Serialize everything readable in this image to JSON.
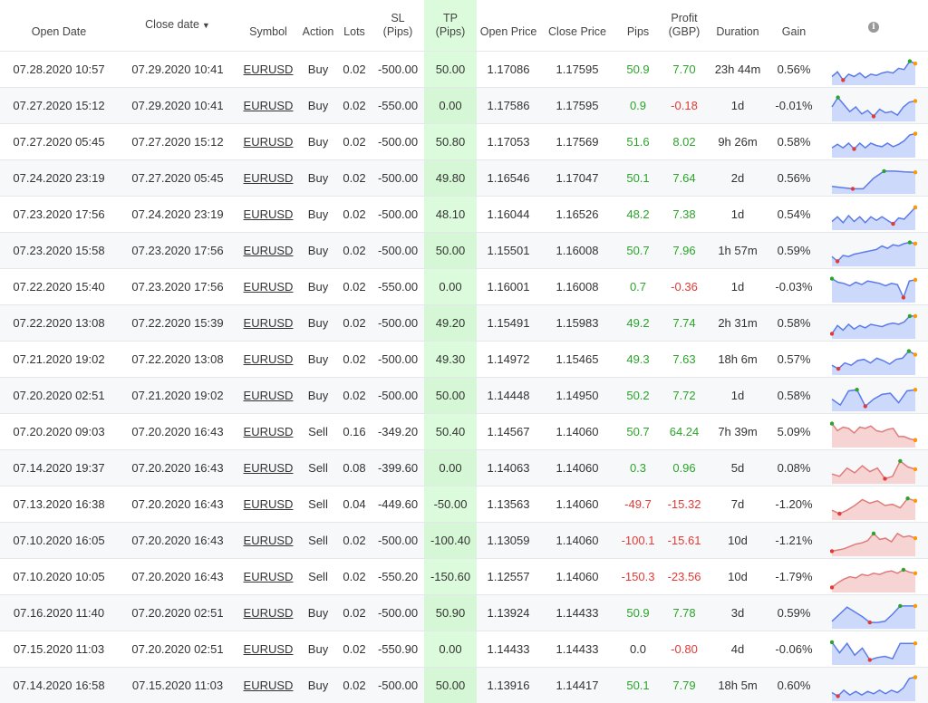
{
  "headers": {
    "open_date": "Open Date",
    "close_date": "Close date",
    "close_date_sort": "▼",
    "symbol": "Symbol",
    "action": "Action",
    "lots": "Lots",
    "sl_line1": "SL",
    "sl_line2": "(Pips)",
    "tp_line1": "TP",
    "tp_line2": "(Pips)",
    "open_price": "Open Price",
    "close_price": "Close Price",
    "pips": "Pips",
    "profit_line1": "Profit",
    "profit_line2": "(GBP)",
    "duration": "Duration",
    "gain": "Gain",
    "info": "i"
  },
  "colors": {
    "positive": "#2aa52a",
    "negative": "#e53935",
    "buy_line": "#5b7bea",
    "buy_fill": "#cdd9fb",
    "sell_line": "#e07b7b",
    "sell_fill": "#f6d4d4",
    "tp_bg": "#dcfbdc"
  },
  "rows": [
    {
      "open": "07.28.2020 10:57",
      "close": "07.29.2020 10:41",
      "symbol": "EURUSD",
      "action": "Buy",
      "lots": "0.02",
      "sl": "-500.00",
      "tp": "50.00",
      "open_price": "1.17086",
      "close_price": "1.17595",
      "pips": "50.9",
      "profit": "7.70",
      "duration": "23h 44m",
      "gain": "0.56%",
      "spark": [
        0.25,
        0.45,
        0.1,
        0.35,
        0.25,
        0.4,
        0.2,
        0.35,
        0.3,
        0.4,
        0.45,
        0.4,
        0.6,
        0.55,
        0.9,
        0.8
      ]
    },
    {
      "open": "07.27.2020 15:12",
      "close": "07.29.2020 10:41",
      "symbol": "EURUSD",
      "action": "Buy",
      "lots": "0.02",
      "sl": "-550.00",
      "tp": "0.00",
      "open_price": "1.17586",
      "close_price": "1.17595",
      "pips": "0.9",
      "profit": "-0.18",
      "duration": "1d",
      "gain": "-0.01%",
      "spark": [
        0.5,
        0.9,
        0.6,
        0.3,
        0.5,
        0.2,
        0.35,
        0.1,
        0.4,
        0.25,
        0.3,
        0.15,
        0.5,
        0.7,
        0.75
      ]
    },
    {
      "open": "07.27.2020 05:45",
      "close": "07.27.2020 15:12",
      "symbol": "EURUSD",
      "action": "Buy",
      "lots": "0.02",
      "sl": "-500.00",
      "tp": "50.80",
      "open_price": "1.17053",
      "close_price": "1.17569",
      "pips": "51.6",
      "profit": "8.02",
      "duration": "9h 26m",
      "gain": "0.58%",
      "spark": [
        0.3,
        0.45,
        0.3,
        0.5,
        0.25,
        0.5,
        0.3,
        0.5,
        0.4,
        0.35,
        0.5,
        0.35,
        0.45,
        0.6,
        0.85,
        0.9
      ]
    },
    {
      "open": "07.24.2020 23:19",
      "close": "07.27.2020 05:45",
      "symbol": "EURUSD",
      "action": "Buy",
      "lots": "0.02",
      "sl": "-500.00",
      "tp": "49.80",
      "open_price": "1.16546",
      "close_price": "1.17047",
      "pips": "50.1",
      "profit": "7.64",
      "duration": "2d",
      "gain": "0.56%",
      "spark": [
        0.2,
        0.15,
        0.1,
        0.1,
        0.55,
        0.85,
        0.85,
        0.82,
        0.8
      ]
    },
    {
      "open": "07.23.2020 17:56",
      "close": "07.24.2020 23:19",
      "symbol": "EURUSD",
      "action": "Buy",
      "lots": "0.02",
      "sl": "-500.00",
      "tp": "48.10",
      "open_price": "1.16044",
      "close_price": "1.16526",
      "pips": "48.2",
      "profit": "7.38",
      "duration": "1d",
      "gain": "0.54%",
      "spark": [
        0.25,
        0.45,
        0.2,
        0.5,
        0.25,
        0.45,
        0.2,
        0.45,
        0.3,
        0.45,
        0.3,
        0.15,
        0.4,
        0.35,
        0.6,
        0.85
      ]
    },
    {
      "open": "07.23.2020 15:58",
      "close": "07.23.2020 17:56",
      "symbol": "EURUSD",
      "action": "Buy",
      "lots": "0.02",
      "sl": "-500.00",
      "tp": "50.00",
      "open_price": "1.15501",
      "close_price": "1.16008",
      "pips": "50.7",
      "profit": "7.96",
      "duration": "1h 57m",
      "gain": "0.59%",
      "spark": [
        0.3,
        0.1,
        0.35,
        0.3,
        0.4,
        0.45,
        0.5,
        0.55,
        0.6,
        0.75,
        0.65,
        0.8,
        0.75,
        0.85,
        0.9,
        0.85
      ]
    },
    {
      "open": "07.22.2020 15:40",
      "close": "07.23.2020 17:56",
      "symbol": "EURUSD",
      "action": "Buy",
      "lots": "0.02",
      "sl": "-550.00",
      "tp": "0.00",
      "open_price": "1.16001",
      "close_price": "1.16008",
      "pips": "0.7",
      "profit": "-0.36",
      "duration": "1d",
      "gain": "-0.03%",
      "spark": [
        0.9,
        0.75,
        0.7,
        0.6,
        0.75,
        0.65,
        0.8,
        0.75,
        0.7,
        0.6,
        0.7,
        0.65,
        0.1,
        0.8,
        0.85
      ]
    },
    {
      "open": "07.22.2020 13:08",
      "close": "07.22.2020 15:39",
      "symbol": "EURUSD",
      "action": "Buy",
      "lots": "0.02",
      "sl": "-500.00",
      "tp": "49.20",
      "open_price": "1.15491",
      "close_price": "1.15983",
      "pips": "49.2",
      "profit": "7.74",
      "duration": "2h 31m",
      "gain": "0.58%",
      "spark": [
        0.1,
        0.45,
        0.25,
        0.5,
        0.3,
        0.45,
        0.35,
        0.5,
        0.45,
        0.4,
        0.5,
        0.55,
        0.5,
        0.6,
        0.85,
        0.85
      ]
    },
    {
      "open": "07.21.2020 19:02",
      "close": "07.22.2020 13:08",
      "symbol": "EURUSD",
      "action": "Buy",
      "lots": "0.02",
      "sl": "-500.00",
      "tp": "49.30",
      "open_price": "1.14972",
      "close_price": "1.15465",
      "pips": "49.3",
      "profit": "7.63",
      "duration": "18h 6m",
      "gain": "0.57%",
      "spark": [
        0.3,
        0.15,
        0.4,
        0.3,
        0.5,
        0.55,
        0.4,
        0.6,
        0.5,
        0.35,
        0.55,
        0.6,
        0.9,
        0.75
      ]
    },
    {
      "open": "07.20.2020 02:51",
      "close": "07.21.2020 19:02",
      "symbol": "EURUSD",
      "action": "Buy",
      "lots": "0.02",
      "sl": "-500.00",
      "tp": "50.00",
      "open_price": "1.14448",
      "close_price": "1.14950",
      "pips": "50.2",
      "profit": "7.72",
      "duration": "1d",
      "gain": "0.58%",
      "spark": [
        0.4,
        0.15,
        0.75,
        0.8,
        0.1,
        0.4,
        0.6,
        0.65,
        0.25,
        0.75,
        0.8
      ]
    },
    {
      "open": "07.20.2020 09:03",
      "close": "07.20.2020 16:43",
      "symbol": "EURUSD",
      "action": "Sell",
      "lots": "0.16",
      "sl": "-349.20",
      "tp": "50.40",
      "open_price": "1.14567",
      "close_price": "1.14060",
      "pips": "50.7",
      "profit": "64.24",
      "duration": "7h 39m",
      "gain": "5.09%",
      "spark": [
        0.9,
        0.6,
        0.75,
        0.7,
        0.5,
        0.75,
        0.7,
        0.8,
        0.6,
        0.55,
        0.65,
        0.7,
        0.35,
        0.35,
        0.25,
        0.2
      ]
    },
    {
      "open": "07.14.2020 19:37",
      "close": "07.20.2020 16:43",
      "symbol": "EURUSD",
      "action": "Sell",
      "lots": "0.08",
      "sl": "-399.60",
      "tp": "0.00",
      "open_price": "1.14063",
      "close_price": "1.14060",
      "pips": "0.3",
      "profit": "0.96",
      "duration": "5d",
      "gain": "0.08%",
      "spark": [
        0.3,
        0.2,
        0.55,
        0.35,
        0.65,
        0.4,
        0.55,
        0.1,
        0.2,
        0.85,
        0.6,
        0.5
      ]
    },
    {
      "open": "07.13.2020 16:38",
      "close": "07.20.2020 16:43",
      "symbol": "EURUSD",
      "action": "Sell",
      "lots": "0.04",
      "sl": "-449.60",
      "tp": "-50.00",
      "open_price": "1.13563",
      "close_price": "1.14060",
      "pips": "-49.7",
      "profit": "-15.32",
      "duration": "7d",
      "gain": "-1.20%",
      "spark": [
        0.3,
        0.15,
        0.3,
        0.5,
        0.75,
        0.6,
        0.7,
        0.5,
        0.55,
        0.4,
        0.8,
        0.7
      ]
    },
    {
      "open": "07.10.2020 16:05",
      "close": "07.20.2020 16:43",
      "symbol": "EURUSD",
      "action": "Sell",
      "lots": "0.02",
      "sl": "-500.00",
      "tp": "-100.40",
      "open_price": "1.13059",
      "close_price": "1.14060",
      "pips": "-100.1",
      "profit": "-15.61",
      "duration": "10d",
      "gain": "-1.21%",
      "spark": [
        0.1,
        0.15,
        0.2,
        0.3,
        0.4,
        0.45,
        0.55,
        0.85,
        0.6,
        0.65,
        0.5,
        0.85,
        0.7,
        0.75,
        0.65
      ]
    },
    {
      "open": "07.10.2020 10:05",
      "close": "07.20.2020 16:43",
      "symbol": "EURUSD",
      "action": "Sell",
      "lots": "0.02",
      "sl": "-550.20",
      "tp": "-150.60",
      "open_price": "1.12557",
      "close_price": "1.14060",
      "pips": "-150.3",
      "profit": "-23.56",
      "duration": "10d",
      "gain": "-1.79%",
      "spark": [
        0.1,
        0.3,
        0.45,
        0.55,
        0.5,
        0.65,
        0.6,
        0.7,
        0.65,
        0.75,
        0.8,
        0.7,
        0.85,
        0.75,
        0.7
      ]
    },
    {
      "open": "07.16.2020 11:40",
      "close": "07.20.2020 02:51",
      "symbol": "EURUSD",
      "action": "Buy",
      "lots": "0.02",
      "sl": "-500.00",
      "tp": "50.90",
      "open_price": "1.13924",
      "close_price": "1.14433",
      "pips": "50.9",
      "profit": "7.78",
      "duration": "3d",
      "gain": "0.59%",
      "spark": [
        0.2,
        0.5,
        0.8,
        0.6,
        0.4,
        0.15,
        0.15,
        0.2,
        0.5,
        0.85,
        0.85,
        0.85
      ]
    },
    {
      "open": "07.15.2020 11:03",
      "close": "07.20.2020 02:51",
      "symbol": "EURUSD",
      "action": "Buy",
      "lots": "0.02",
      "sl": "-550.90",
      "tp": "0.00",
      "open_price": "1.14433",
      "close_price": "1.14433",
      "pips": "0.0",
      "profit": "-0.80",
      "duration": "4d",
      "gain": "-0.06%",
      "spark": [
        0.85,
        0.4,
        0.8,
        0.3,
        0.6,
        0.1,
        0.2,
        0.25,
        0.15,
        0.8,
        0.8,
        0.8
      ]
    },
    {
      "open": "07.14.2020 16:58",
      "close": "07.15.2020 11:03",
      "symbol": "EURUSD",
      "action": "Buy",
      "lots": "0.02",
      "sl": "-500.00",
      "tp": "50.00",
      "open_price": "1.13916",
      "close_price": "1.14417",
      "pips": "50.1",
      "profit": "7.79",
      "duration": "18h 5m",
      "gain": "0.60%",
      "spark": [
        0.25,
        0.1,
        0.35,
        0.15,
        0.3,
        0.15,
        0.3,
        0.2,
        0.35,
        0.2,
        0.35,
        0.25,
        0.45,
        0.85,
        0.9
      ]
    }
  ]
}
